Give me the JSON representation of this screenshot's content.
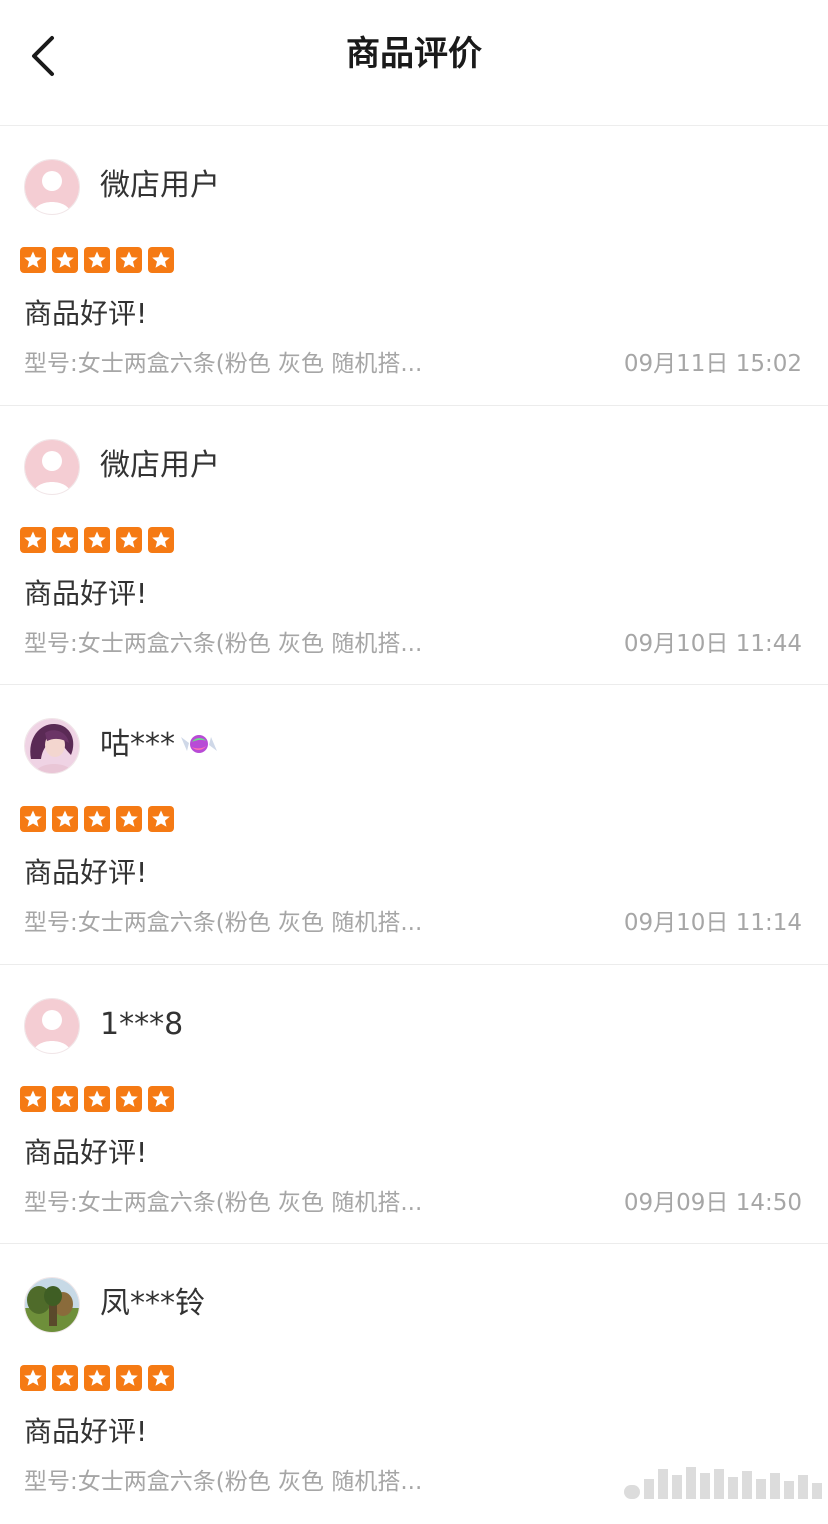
{
  "header": {
    "title": "商品评价",
    "back_icon": "chevron-left-icon"
  },
  "colors": {
    "star": "#f57a14",
    "divider": "#ececec",
    "muted_text": "#a6a6a6",
    "avatar_default": "#f4cdd3"
  },
  "reviews": [
    {
      "username": "微店用户",
      "avatar": "default-avatar",
      "rating": 5,
      "text": "商品好评!",
      "spec": "型号:女士两盒六条(粉色 灰色 随机搭...",
      "time": "09月11日 15:02"
    },
    {
      "username": "微店用户",
      "avatar": "default-avatar",
      "rating": 5,
      "text": "商品好评!",
      "spec": "型号:女士两盒六条(粉色 灰色 随机搭...",
      "time": "09月10日 11:44"
    },
    {
      "username": "咕***",
      "avatar": "girl-portrait-avatar",
      "name_icon": "candy-icon",
      "rating": 5,
      "text": "商品好评!",
      "spec": "型号:女士两盒六条(粉色 灰色 随机搭...",
      "time": "09月10日 11:14"
    },
    {
      "username": "1***8",
      "avatar": "default-avatar",
      "rating": 5,
      "text": "商品好评!",
      "spec": "型号:女士两盒六条(粉色 灰色 随机搭...",
      "time": "09月09日 14:50"
    },
    {
      "username": "凤***铃",
      "avatar": "landscape-photo-avatar",
      "rating": 5,
      "text": "商品好评!",
      "spec": "型号:女士两盒六条(粉色 灰色 随机搭..."
    }
  ]
}
